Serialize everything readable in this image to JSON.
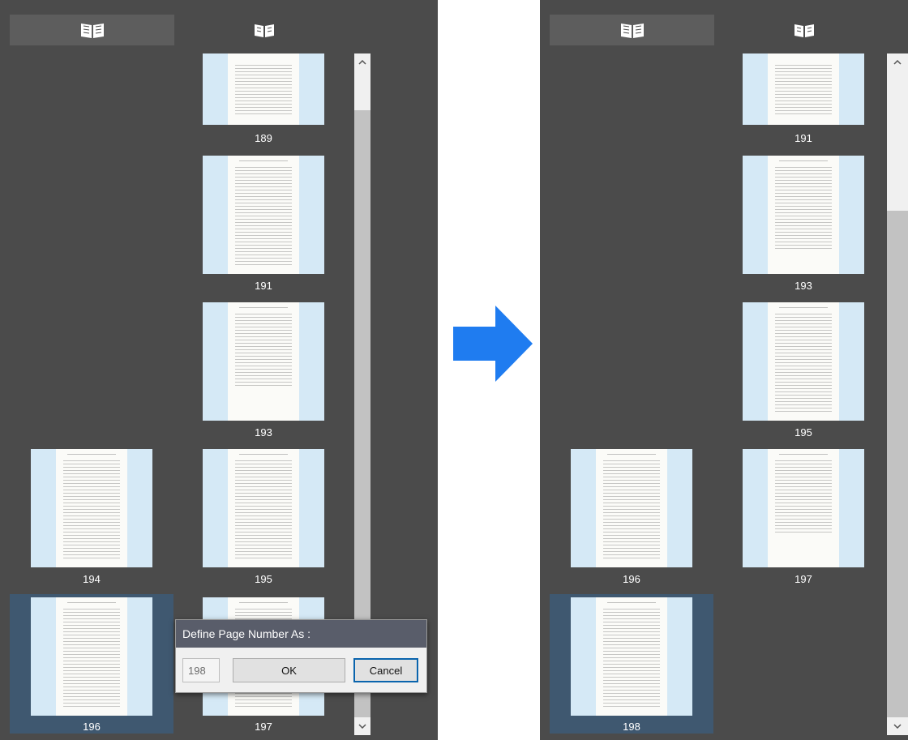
{
  "left_panel": {
    "tabs": [
      {
        "icon": "book-icon",
        "active": true
      },
      {
        "icon": "book-icon",
        "active": false
      }
    ],
    "thumbnails": [
      {
        "page": "189"
      },
      {
        "page": "191"
      },
      {
        "page": "193"
      },
      {
        "page": "194"
      },
      {
        "page": "195"
      },
      {
        "page": "196",
        "selected": true
      },
      {
        "page": "197"
      }
    ],
    "dialog": {
      "title": "Define Page Number As :",
      "value": "198",
      "ok_label": "OK",
      "cancel_label": "Cancel"
    }
  },
  "right_panel": {
    "tabs": [
      {
        "icon": "book-icon",
        "active": true
      },
      {
        "icon": "book-icon",
        "active": false
      }
    ],
    "thumbnails": [
      {
        "page": "191"
      },
      {
        "page": "193"
      },
      {
        "page": "195"
      },
      {
        "page": "196"
      },
      {
        "page": "197"
      },
      {
        "page": "198",
        "selected": true
      }
    ]
  },
  "arrow": {
    "icon": "right-arrow-icon",
    "color": "#1f7cf0"
  },
  "colors": {
    "panel_bg": "#4b4b4b",
    "thumb_bg": "#d5e9f6",
    "selection": "#3f5870"
  }
}
